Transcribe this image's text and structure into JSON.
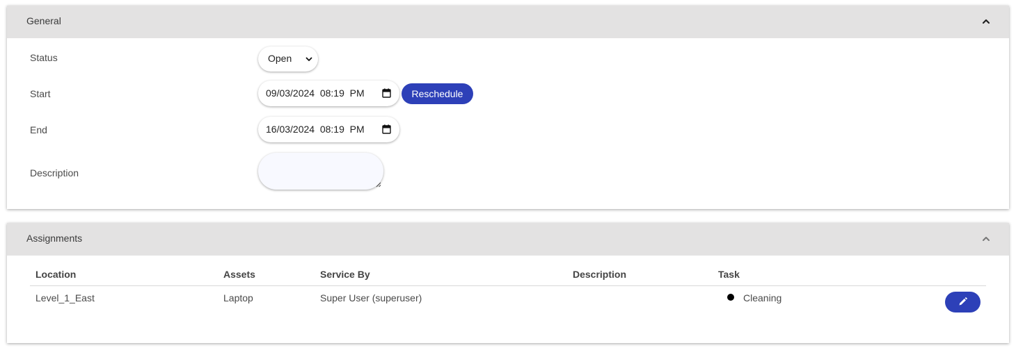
{
  "general": {
    "title": "General",
    "fields": {
      "status": {
        "label": "Status",
        "value": "Open"
      },
      "start": {
        "label": "Start",
        "value": "09/03/2024  08:19  PM"
      },
      "end": {
        "label": "End",
        "value": "16/03/2024  08:19  PM"
      },
      "description": {
        "label": "Description",
        "value": ""
      }
    },
    "reschedule_label": "Reschedule"
  },
  "assignments": {
    "title": "Assignments",
    "columns": [
      "Location",
      "Assets",
      "Service By",
      "Description",
      "Task"
    ],
    "rows": [
      {
        "location": "Level_1_East",
        "assets": "Laptop",
        "service_by": "Super User (superuser)",
        "description": "",
        "task": "Cleaning"
      }
    ]
  },
  "colors": {
    "accent": "#2d40b8",
    "header_bg": "#e3e2e2"
  },
  "icons": [
    "chevron-up-icon",
    "chevron-down-icon",
    "calendar-icon",
    "pencil-icon",
    "resize-grip-icon"
  ]
}
